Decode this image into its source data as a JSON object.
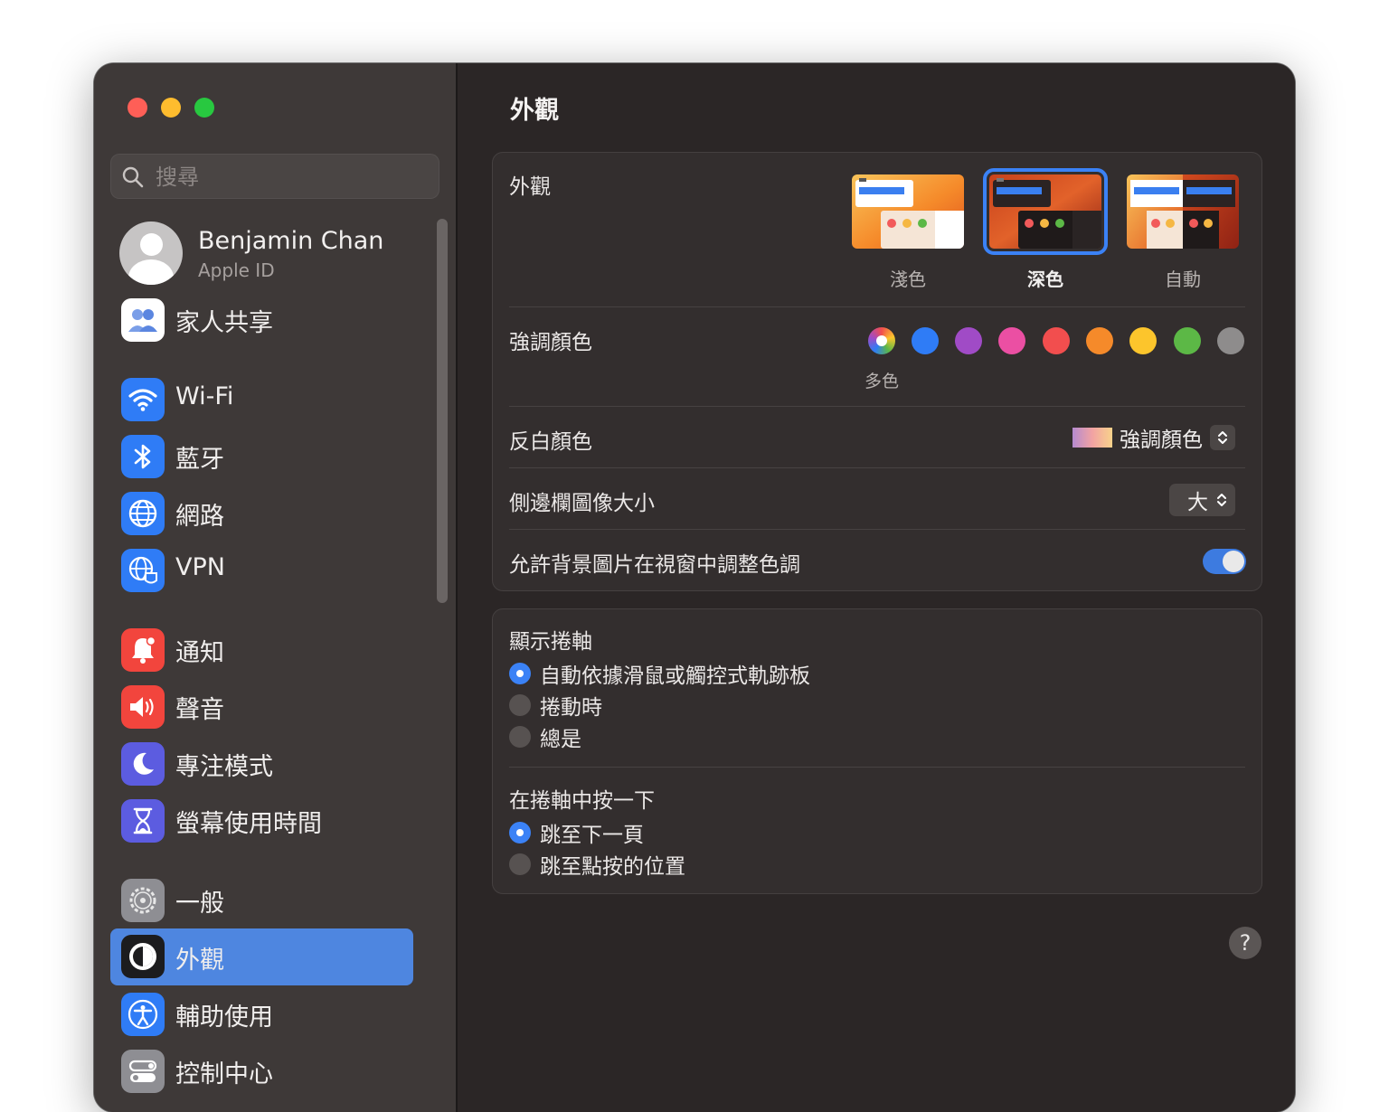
{
  "search": {
    "placeholder": "搜尋"
  },
  "profile": {
    "name": "Benjamin Chan",
    "subtitle": "Apple ID"
  },
  "sidebar": {
    "items": [
      {
        "label": "家人共享",
        "icon": "family-sharing-icon",
        "color": "#ffffff"
      },
      {
        "label": "Wi-Fi",
        "icon": "wifi-icon",
        "color": "#2f7cf6"
      },
      {
        "label": "藍牙",
        "icon": "bluetooth-icon",
        "color": "#2f7cf6"
      },
      {
        "label": "網路",
        "icon": "globe-icon",
        "color": "#2f7cf6"
      },
      {
        "label": "VPN",
        "icon": "vpn-globe-icon",
        "color": "#2f7cf6"
      },
      {
        "label": "通知",
        "icon": "bell-icon",
        "color": "#f2453d"
      },
      {
        "label": "聲音",
        "icon": "speaker-icon",
        "color": "#f2453d"
      },
      {
        "label": "專注模式",
        "icon": "moon-icon",
        "color": "#5c5ce0"
      },
      {
        "label": "螢幕使用時間",
        "icon": "hourglass-icon",
        "color": "#5c5ce0"
      },
      {
        "label": "一般",
        "icon": "gear-icon",
        "color": "#8e8e93"
      },
      {
        "label": "外觀",
        "icon": "appearance-icon",
        "color": "#1c1c1e"
      },
      {
        "label": "輔助使用",
        "icon": "accessibility-icon",
        "color": "#2f7cf6"
      },
      {
        "label": "控制中心",
        "icon": "control-center-icon",
        "color": "#8e8e93"
      }
    ],
    "selected": "外觀"
  },
  "main": {
    "title": "外觀",
    "appearance": {
      "label": "外觀",
      "options": [
        {
          "label": "淺色"
        },
        {
          "label": "深色"
        },
        {
          "label": "自動"
        }
      ],
      "selected": "深色"
    },
    "accent": {
      "label": "強調顏色",
      "colors": [
        "multicolor",
        "#2f7cf6",
        "#a04bc6",
        "#eb4fa3",
        "#f24e4e",
        "#f58a2a",
        "#fcc52c",
        "#5cb846",
        "#8e8c8c"
      ],
      "selected_caption": "多色"
    },
    "highlight": {
      "label": "反白顏色",
      "value": "強調顏色"
    },
    "sidebar_icon_size": {
      "label": "側邊欄圖像大小",
      "value": "大"
    },
    "wallpaper_tint": {
      "label": "允許背景圖片在視窗中調整色調",
      "enabled": true
    },
    "scrollbars": {
      "title": "顯示捲軸",
      "options": [
        "自動依據滑鼠或觸控式軌跡板",
        "捲動時",
        "總是"
      ],
      "selected": 0
    },
    "click_scrollbar": {
      "title": "在捲軸中按一下",
      "options": [
        "跳至下一頁",
        "跳至點按的位置"
      ],
      "selected": 0
    },
    "help": "?"
  }
}
